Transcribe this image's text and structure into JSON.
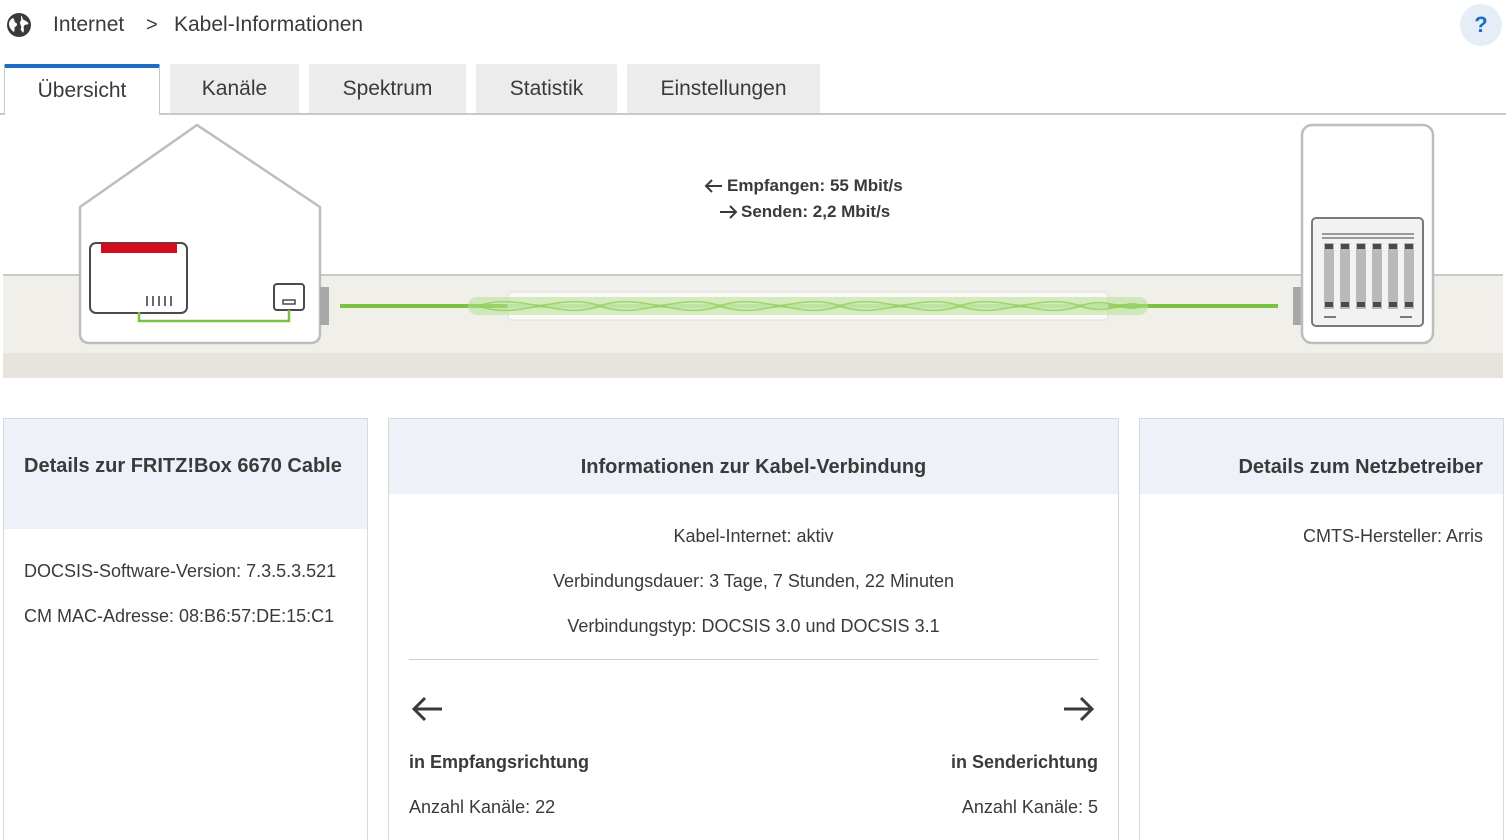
{
  "breadcrumb": {
    "icon": "globe-icon",
    "items": [
      "Internet",
      "Kabel-Informationen"
    ],
    "separator": ">"
  },
  "help": {
    "label": "?"
  },
  "tabs": [
    {
      "label": "Übersicht",
      "active": true
    },
    {
      "label": "Kanäle",
      "active": false
    },
    {
      "label": "Spektrum",
      "active": false
    },
    {
      "label": "Statistik",
      "active": false
    },
    {
      "label": "Einstellungen",
      "active": false
    }
  ],
  "illustration": {
    "downstream": "Empfangen: 55 Mbit/s",
    "upstream": "Senden: 2,2 Mbit/s",
    "colors": {
      "cable": "#7cc242",
      "fritzbox_red": "#d00c1e",
      "ground": "#eceae3"
    }
  },
  "device_card": {
    "title": "Details zur FRITZ!Box 6670 Cable",
    "docsis_version": "DOCSIS-Software-Version: 7.3.5.3.521",
    "mac": "CM MAC-Adresse: 08:B6:57:DE:15:C1"
  },
  "connection_card": {
    "title": "Informationen zur Kabel-Verbindung",
    "status": "Kabel-Internet: aktiv",
    "duration": "Verbindungsdauer: 3 Tage, 7 Stunden, 22 Minuten",
    "type": "Verbindungstyp: DOCSIS 3.0 und DOCSIS 3.1",
    "downstream_title": "in Empfangsrichtung",
    "downstream_channels": "Anzahl Kanäle: 22",
    "upstream_title": "in Senderichtung",
    "upstream_channels": "Anzahl Kanäle: 5"
  },
  "operator_card": {
    "title": "Details zum Netzbetreiber",
    "cmts": "CMTS-Hersteller: Arris"
  },
  "accent_color": "#1c6ec4"
}
